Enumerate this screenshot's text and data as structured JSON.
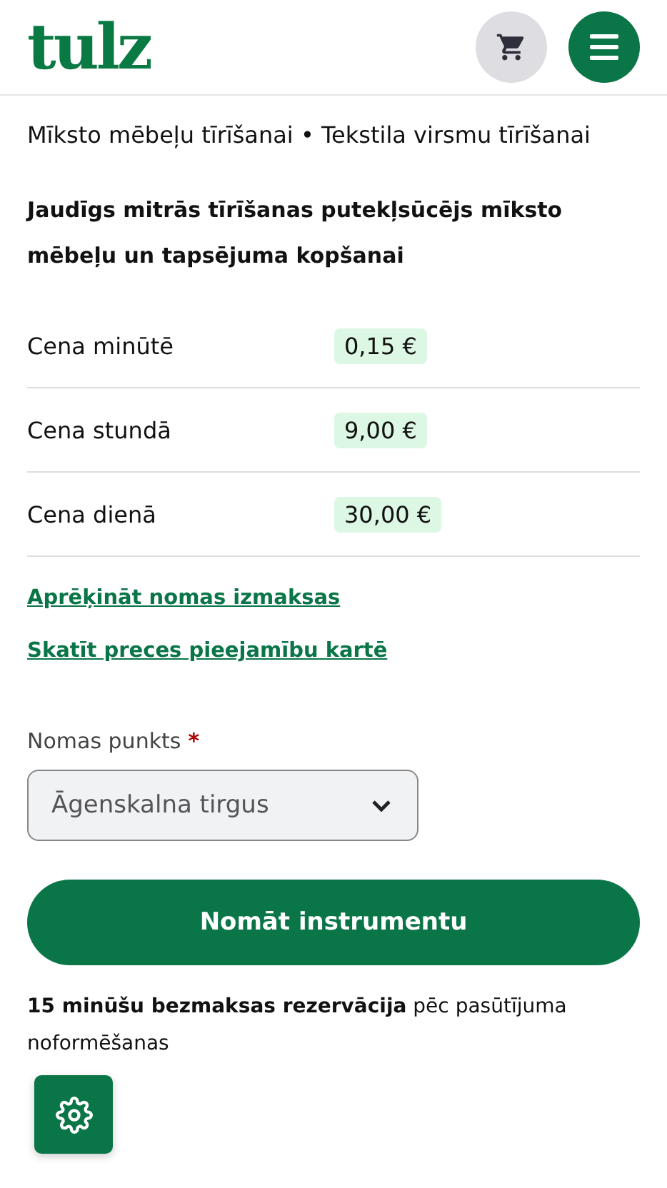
{
  "header": {
    "logo": "tulz",
    "cart_button": {
      "kind": "cart"
    },
    "menu_button": {
      "kind": "menu"
    }
  },
  "category": "Mīksto mēbeļu tīrīšanai • Tekstila virsmu tīrīšanai",
  "product_title": "Jaudīgs mitrās tīrīšanas putekļsūcējs mīksto mēbeļu un tapsējuma kopšanai",
  "prices": [
    {
      "label": "Cena minūtē",
      "value": "0,15 €"
    },
    {
      "label": "Cena stundā",
      "value": "9,00 €"
    },
    {
      "label": "Cena dienā",
      "value": "30,00 €"
    }
  ],
  "links": [
    "Aprēķināt nomas izmaksas",
    "Skatīt preces pieejamību kartē"
  ],
  "rental_point": {
    "label": "Nomas punkts",
    "required_mark": "*",
    "value": "Āgenskalna tirgus"
  },
  "primary_button": "Nomāt instrumentu",
  "note": "**15 minūšu bezmaksas rezervācija** pēc pasūtījuma noformēšanas",
  "settings_button": {
    "kind": "gear"
  }
}
